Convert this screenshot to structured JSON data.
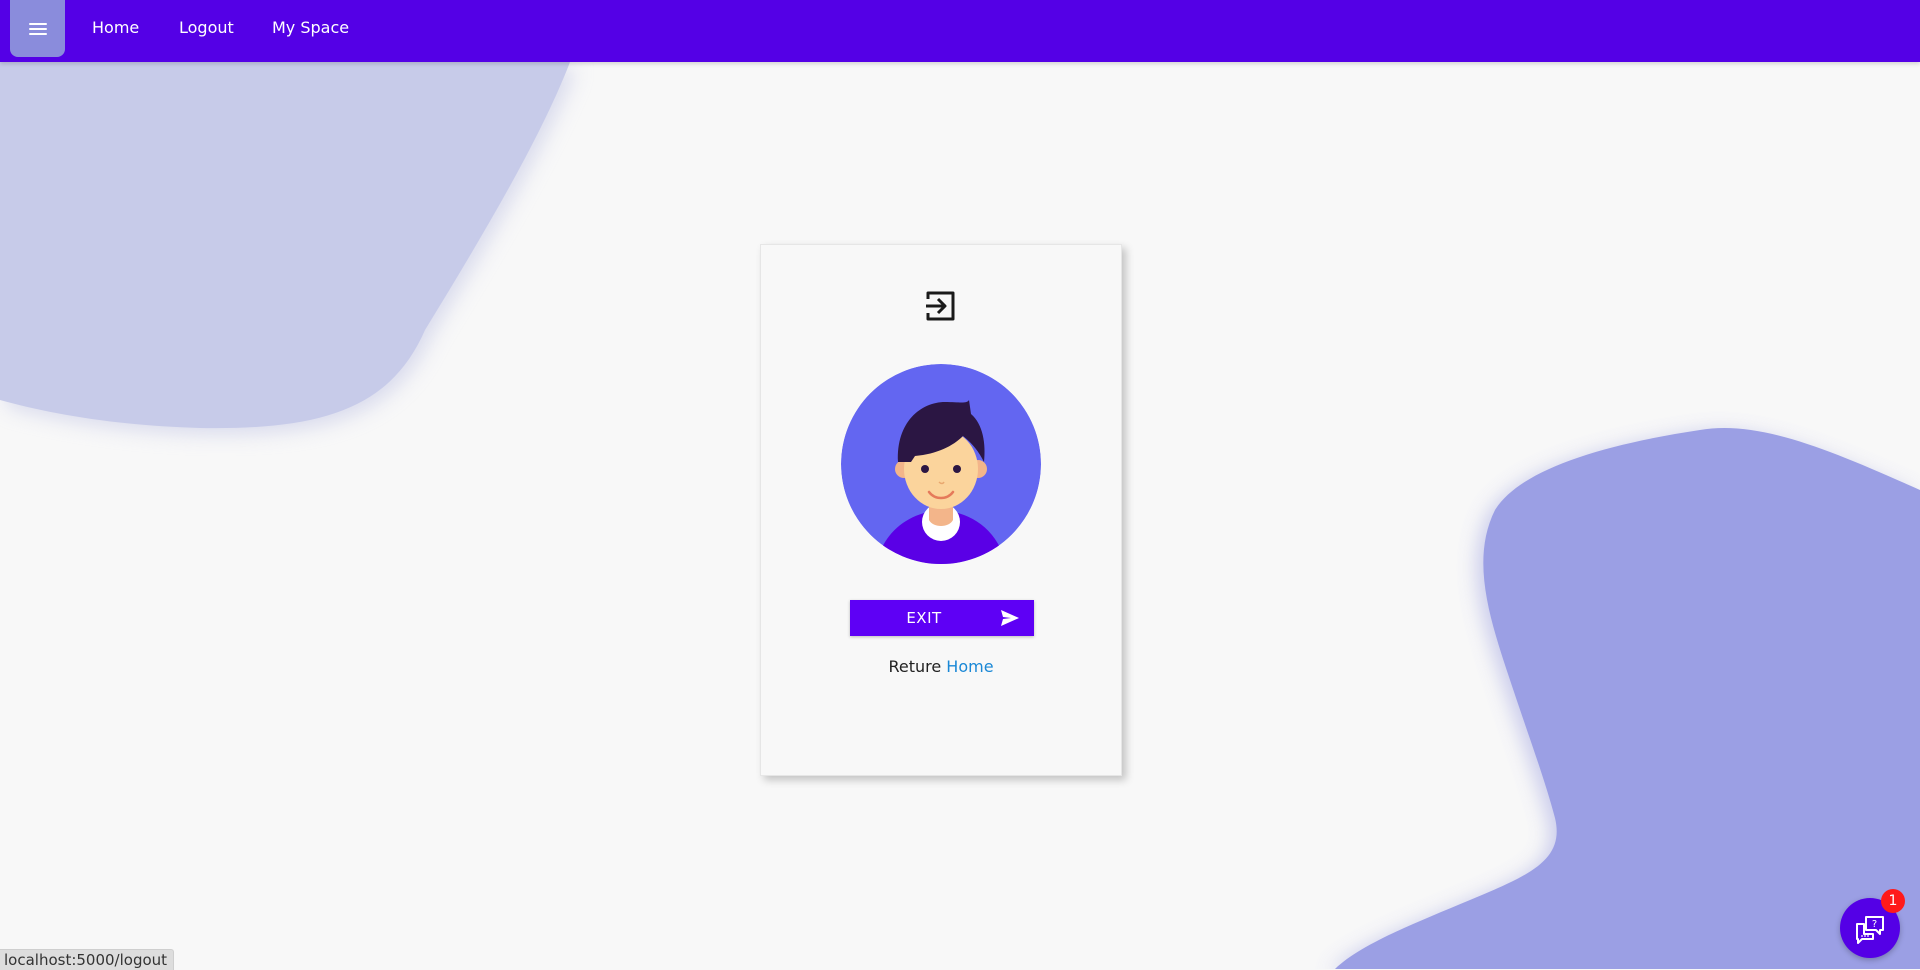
{
  "nav": {
    "menu_icon": "hamburger-menu-icon",
    "links": [
      {
        "label": "Home"
      },
      {
        "label": "Logout"
      },
      {
        "label": "My Space"
      }
    ]
  },
  "card": {
    "top_icon": "logout-icon",
    "avatar": "user-avatar-illustration",
    "exit_button": {
      "label": "EXIT",
      "icon": "send-icon"
    },
    "return_text": "Reture",
    "return_link": "Home"
  },
  "chat_widget": {
    "icon": "chat-help-icon",
    "badge_count": "1"
  },
  "status_bar": {
    "url": "localhost:5000/logout"
  },
  "colors": {
    "primary": "#5400e6",
    "button": "#5e00f5",
    "link": "#1a88d6",
    "blob_left": "#c7cbe9",
    "blob_right": "#9b9fe4",
    "avatar_bg": "#6366f1",
    "badge": "#ff1a1a"
  }
}
